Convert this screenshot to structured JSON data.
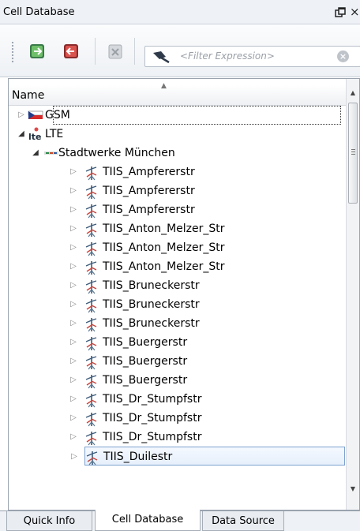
{
  "panel": {
    "title": "Cell Database"
  },
  "toolbar": {
    "buttons": [
      {
        "name": "import-button",
        "icon": "import-icon"
      },
      {
        "name": "export-button",
        "icon": "export-icon"
      },
      {
        "name": "delete-button",
        "icon": "delete-icon"
      }
    ],
    "filter": {
      "placeholder": "<Filter Expression>",
      "value": ""
    }
  },
  "tree": {
    "column_header": "Name",
    "rows": [
      {
        "label": "GSM",
        "level": 0,
        "expander": "collapsed",
        "icon": "flag-icon",
        "state": "focused"
      },
      {
        "label": "LTE",
        "level": 0,
        "expander": "expanded",
        "icon": "lte-icon"
      },
      {
        "label": "Stadtwerke München",
        "level": 1,
        "expander": "expanded",
        "icon": "operator-icon"
      },
      {
        "label": "TIIS_Ampfererstr",
        "level": 2,
        "expander": "collapsed",
        "icon": "antenna-icon"
      },
      {
        "label": "TIIS_Ampfererstr",
        "level": 2,
        "expander": "collapsed",
        "icon": "antenna-icon"
      },
      {
        "label": "TIIS_Ampfererstr",
        "level": 2,
        "expander": "collapsed",
        "icon": "antenna-icon"
      },
      {
        "label": "TIIS_Anton_Melzer_Str",
        "level": 2,
        "expander": "collapsed",
        "icon": "antenna-icon"
      },
      {
        "label": "TIIS_Anton_Melzer_Str",
        "level": 2,
        "expander": "collapsed",
        "icon": "antenna-icon"
      },
      {
        "label": "TIIS_Anton_Melzer_Str",
        "level": 2,
        "expander": "collapsed",
        "icon": "antenna-icon"
      },
      {
        "label": "TIIS_Bruneckerstr",
        "level": 2,
        "expander": "collapsed",
        "icon": "antenna-icon"
      },
      {
        "label": "TIIS_Bruneckerstr",
        "level": 2,
        "expander": "collapsed",
        "icon": "antenna-icon"
      },
      {
        "label": "TIIS_Bruneckerstr",
        "level": 2,
        "expander": "collapsed",
        "icon": "antenna-icon"
      },
      {
        "label": "TIIS_Buergerstr",
        "level": 2,
        "expander": "collapsed",
        "icon": "antenna-icon"
      },
      {
        "label": "TIIS_Buergerstr",
        "level": 2,
        "expander": "collapsed",
        "icon": "antenna-icon"
      },
      {
        "label": "TIIS_Buergerstr",
        "level": 2,
        "expander": "collapsed",
        "icon": "antenna-icon"
      },
      {
        "label": "TIIS_Dr_Stumpfstr",
        "level": 2,
        "expander": "collapsed",
        "icon": "antenna-icon"
      },
      {
        "label": "TIIS_Dr_Stumpfstr",
        "level": 2,
        "expander": "collapsed",
        "icon": "antenna-icon"
      },
      {
        "label": "TIIS_Dr_Stumpfstr",
        "level": 2,
        "expander": "collapsed",
        "icon": "antenna-icon"
      },
      {
        "label": "TIIS_Duilestr",
        "level": 2,
        "expander": "collapsed",
        "icon": "antenna-icon",
        "state": "selected"
      }
    ]
  },
  "tabs": [
    {
      "label": "Quick Info",
      "active": false
    },
    {
      "label": "Cell Database",
      "active": true
    },
    {
      "label": "Data Source",
      "active": false
    }
  ],
  "colors": {
    "selection_border": "#7da2ce",
    "selection_fill": "#e6effb",
    "panel_bg": "#eef1f5"
  }
}
